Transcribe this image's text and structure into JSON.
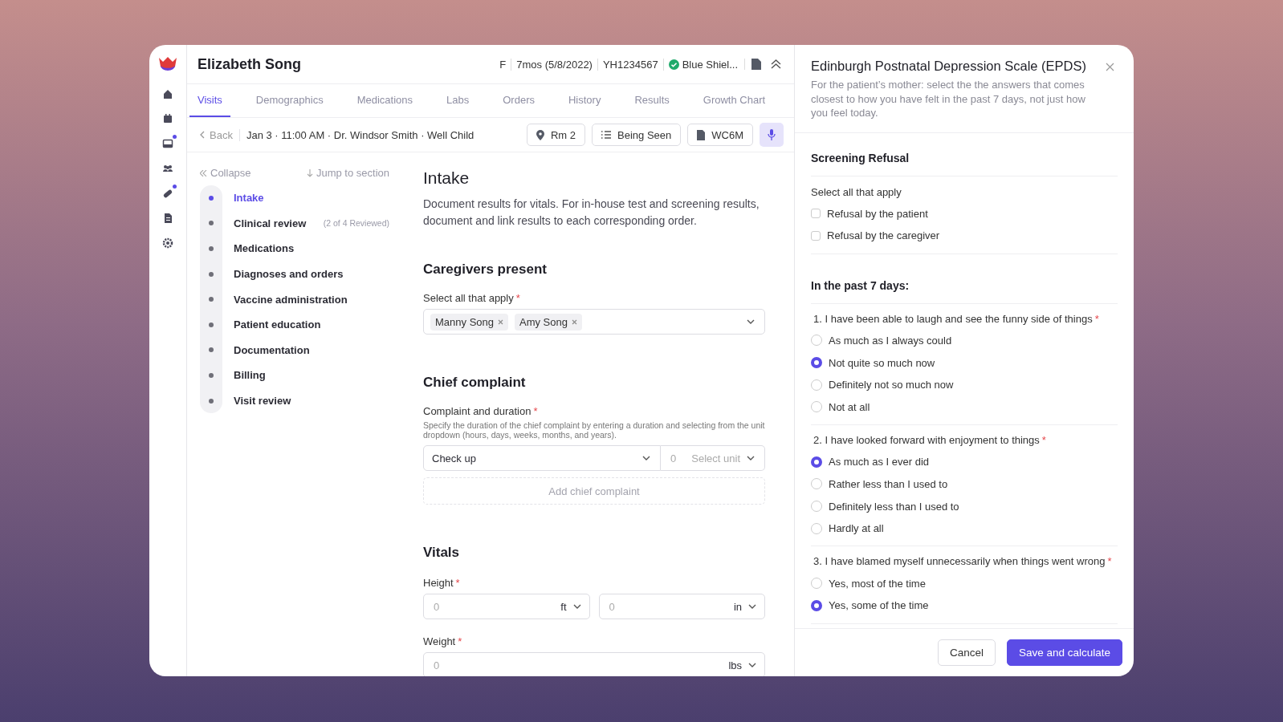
{
  "rail": {
    "items": [
      {
        "kind": "home",
        "badge": false
      },
      {
        "kind": "calendar",
        "badge": false
      },
      {
        "kind": "inbox",
        "badge": true
      },
      {
        "kind": "people",
        "badge": false
      },
      {
        "kind": "pill",
        "badge": true
      },
      {
        "kind": "document",
        "badge": false
      },
      {
        "kind": "settings",
        "badge": false
      }
    ]
  },
  "patient": {
    "name": "Elizabeth Song",
    "sex": "F",
    "age": "7mos (5/8/2022)",
    "mrn": "YH1234567",
    "insurance": "Blue Shiel...",
    "insurance_verified": true
  },
  "tabs": [
    {
      "label": "Visits",
      "selected": true
    },
    {
      "label": "Demographics",
      "selected": false
    },
    {
      "label": "Medications",
      "selected": false
    },
    {
      "label": "Labs",
      "selected": false
    },
    {
      "label": "Orders",
      "selected": false
    },
    {
      "label": "History",
      "selected": false
    },
    {
      "label": "Results",
      "selected": false
    },
    {
      "label": "Growth Chart",
      "selected": false
    }
  ],
  "visit_bar": {
    "back": "Back",
    "summary": "Jan 3 · 11:00 AM · Dr. Windsor Smith · Well Child",
    "room": "Rm 2",
    "status": "Being Seen",
    "visit_code": "WC6M",
    "mic_active": true
  },
  "outline": {
    "collapse": "Collapse",
    "jump": "Jump to section",
    "items": [
      {
        "label": "Intake",
        "selected": true
      },
      {
        "label": "Clinical review",
        "selected": false,
        "note": "(2 of 4 Reviewed)"
      },
      {
        "label": "Medications",
        "selected": false
      },
      {
        "label": "Diagnoses and orders",
        "selected": false
      },
      {
        "label": "Vaccine administration",
        "selected": false
      },
      {
        "label": "Patient education",
        "selected": false
      },
      {
        "label": "Documentation",
        "selected": false
      },
      {
        "label": "Billing",
        "selected": false
      },
      {
        "label": "Visit review",
        "selected": false
      }
    ]
  },
  "intake": {
    "title": "Intake",
    "description": "Document results for vitals. For in-house test and screening results, document and link results to each corresponding order.",
    "caregivers": {
      "title": "Caregivers present",
      "label": "Select all that apply",
      "required": "*",
      "chips": [
        "Manny Song",
        "Amy Song"
      ]
    },
    "chief_complaint": {
      "title": "Chief complaint",
      "label": "Complaint and duration",
      "required": "*",
      "help": "Specify the duration of the chief complaint by entering a duration and selecting from the unit dropdown (hours, days, weeks, months, and years).",
      "complaint": "Check up",
      "duration_placeholder": "0",
      "unit_placeholder": "Select unit",
      "add": "Add chief complaint"
    },
    "vitals": {
      "title": "Vitals",
      "fields": [
        {
          "label": "Height",
          "required": "*",
          "inputs": [
            {
              "placeholder": "0",
              "unit": "ft"
            },
            {
              "placeholder": "0",
              "unit": "in"
            }
          ]
        },
        {
          "label": "Weight",
          "required": "*",
          "inputs": [
            {
              "placeholder": "0",
              "unit": "lbs"
            }
          ]
        }
      ]
    }
  },
  "panel": {
    "title": "Edinburgh Postnatal Depression Scale (EPDS)",
    "description": "For the patient’s mother: select the the answers that comes closest to how you have felt in the past 7 days, not just how you feel today.",
    "refusal": {
      "title": "Screening Refusal",
      "label": "Select all that apply",
      "options": [
        {
          "label": "Refusal by the patient",
          "checked": false
        },
        {
          "label": "Refusal by the caregiver",
          "checked": false
        }
      ]
    },
    "questions_title": "In the past 7 days:",
    "questions": [
      {
        "text": "1. I have been able to laugh and see the funny side of things",
        "required": "*",
        "options": [
          {
            "label": "As much as I always could",
            "selected": false
          },
          {
            "label": "Not quite so much now",
            "selected": true
          },
          {
            "label": "Definitely not so much now",
            "selected": false
          },
          {
            "label": "Not at all",
            "selected": false
          }
        ]
      },
      {
        "text": "2. I have looked forward with enjoyment to things",
        "required": "*",
        "options": [
          {
            "label": "As much as I ever did",
            "selected": true
          },
          {
            "label": "Rather less than I used to",
            "selected": false
          },
          {
            "label": "Definitely less than I used to",
            "selected": false
          },
          {
            "label": "Hardly at all",
            "selected": false
          }
        ]
      },
      {
        "text": "3. I have blamed myself unnecessarily when things went wrong",
        "required": "*",
        "options": [
          {
            "label": "Yes, most of the time",
            "selected": false
          },
          {
            "label": "Yes, some of the time",
            "selected": true
          }
        ]
      }
    ],
    "buttons": [
      {
        "label": "Cancel",
        "kind": "secondary"
      },
      {
        "label": "Save and calculate",
        "kind": "primary"
      }
    ]
  }
}
